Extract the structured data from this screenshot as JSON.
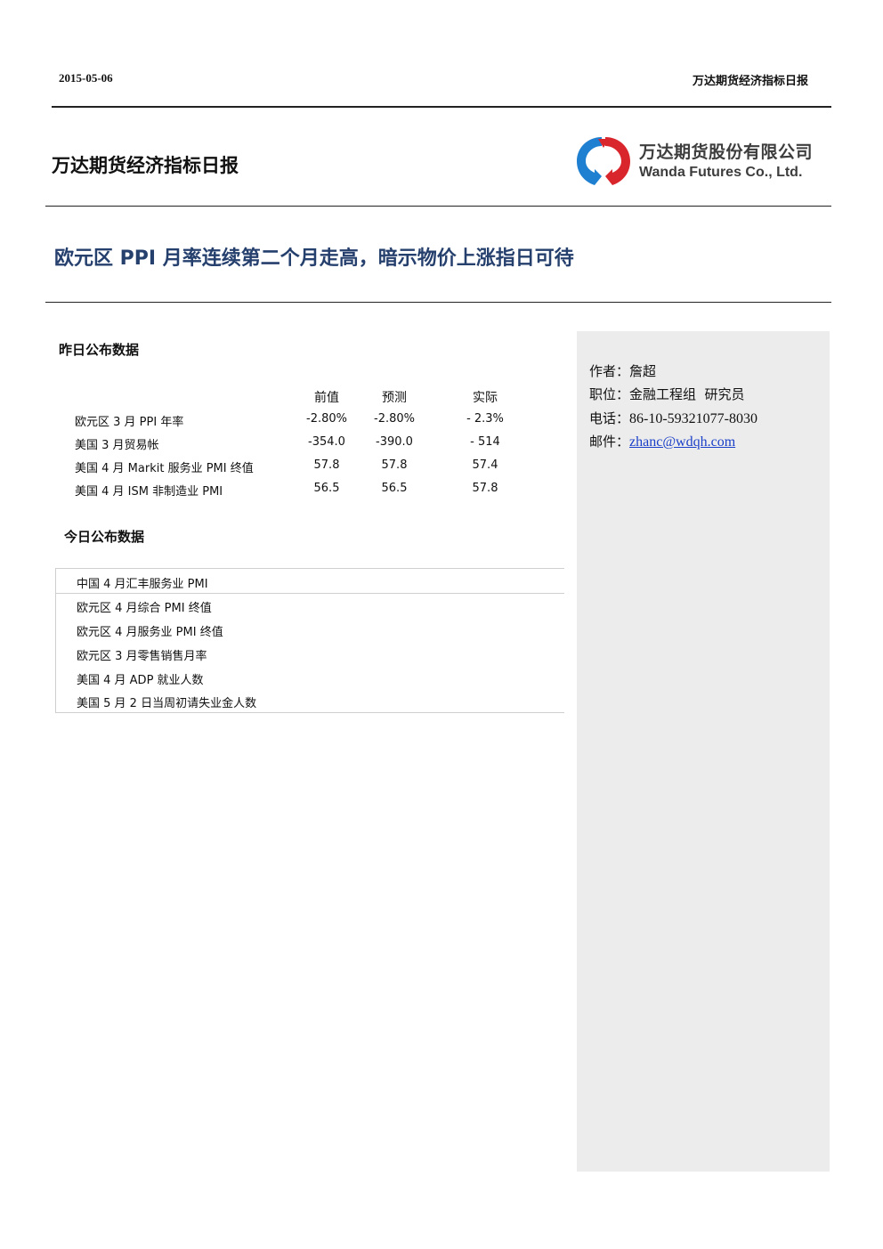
{
  "header": {
    "date": "2015-05-06",
    "report_title": "万达期货经济指标日报"
  },
  "title_block": {
    "report_name": "万达期货经济指标日报",
    "logo_cn": "万达期货股份有限公司",
    "logo_en": "Wanda Futures Co., Ltd."
  },
  "headline": "欧元区 PPI 月率连续第二个月走高，暗示物价上涨指日可待",
  "yesterday": {
    "title": "昨日公布数据",
    "columns": [
      "前值",
      "预测",
      "实际"
    ],
    "rows": [
      {
        "name": "欧元区 3 月 PPI 年率",
        "prev": "-2.80%",
        "forecast": "-2.80%",
        "actual": "- 2.3%"
      },
      {
        "name": "美国 3 月贸易帐",
        "prev": "-354.0",
        "forecast": "-390.0",
        "actual": "- 514"
      },
      {
        "name": "美国 4 月 Markit 服务业 PMI 终值",
        "prev": "57.8",
        "forecast": "57.8",
        "actual": "57.4"
      },
      {
        "name": "美国 4 月 ISM 非制造业 PMI",
        "prev": "56.5",
        "forecast": "56.5",
        "actual": "57.8"
      }
    ]
  },
  "today": {
    "title": "今日公布数据",
    "items": [
      "中国 4 月汇丰服务业 PMI",
      "欧元区 4 月综合 PMI 终值",
      "欧元区 4 月服务业 PMI 终值",
      "欧元区 3 月零售销售月率",
      "美国 4 月 ADP 就业人数",
      "美国 5 月 2 日当周初请失业金人数"
    ]
  },
  "author": {
    "name_label": "作者：",
    "name": "詹超",
    "position_label": "职位：",
    "position": "金融工程组  研究员",
    "phone_label": "电话：",
    "phone": "86-10-59321077-8030",
    "email_label": "邮件：",
    "email": "zhanc@wdqh.com"
  },
  "colors": {
    "headline": "#26406e",
    "sidebar_bg": "#ececec",
    "link": "#1a3fc8",
    "logo_red": "#d9262c",
    "logo_blue": "#1f7fd0"
  }
}
